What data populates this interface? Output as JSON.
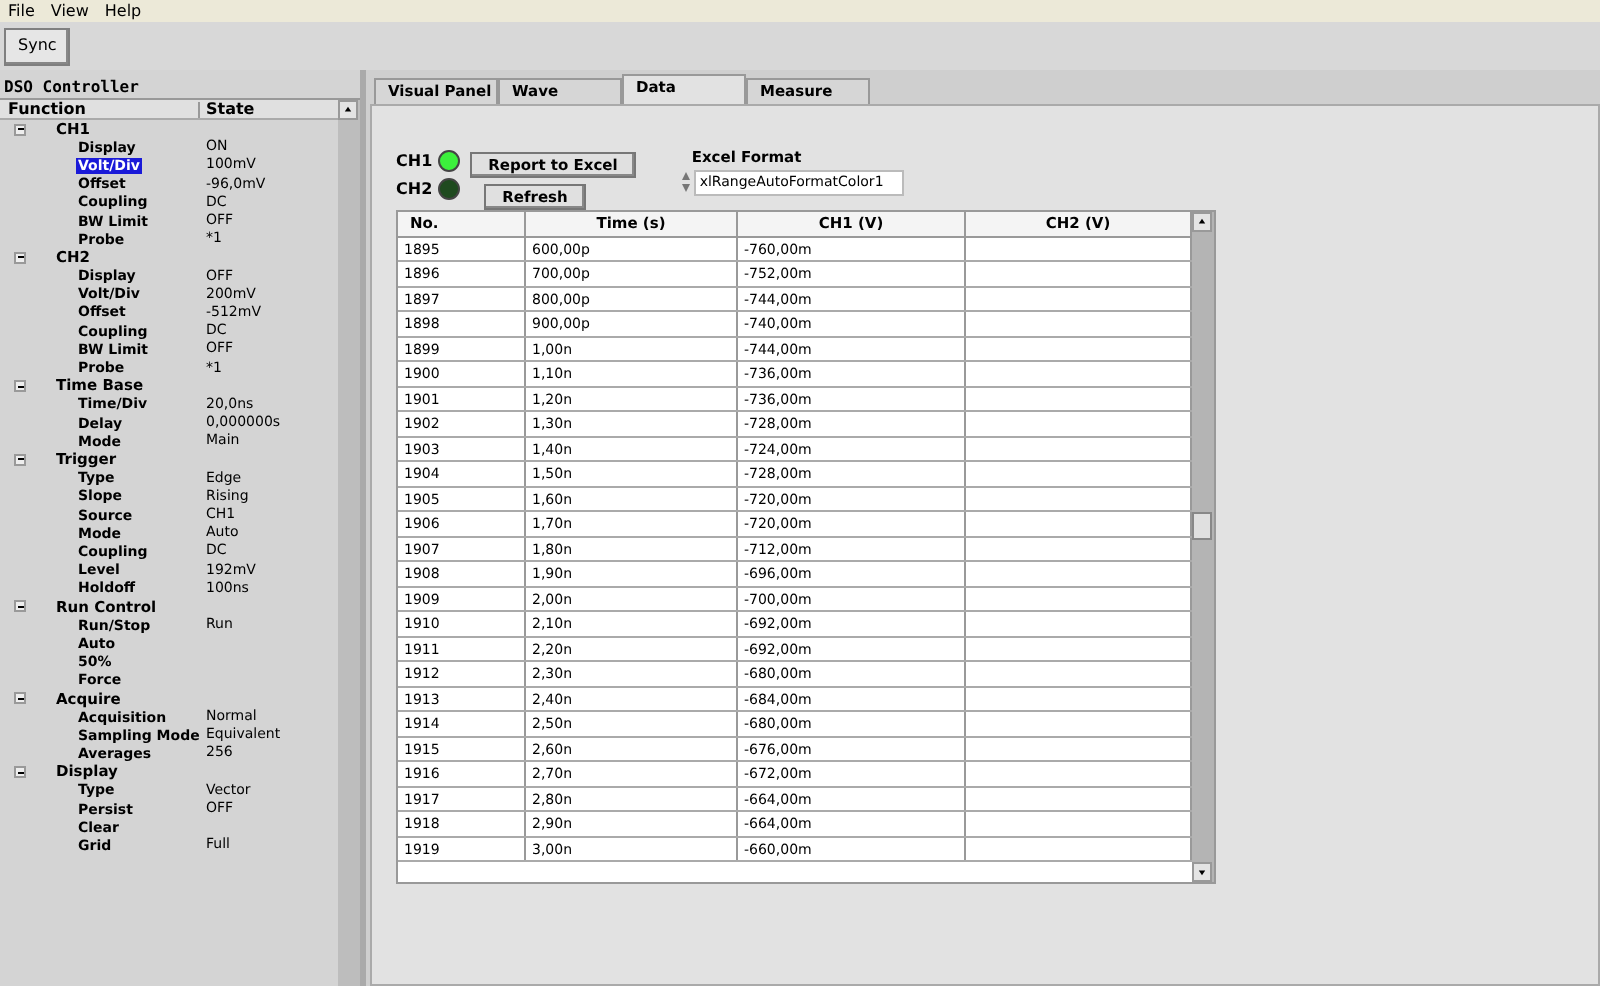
{
  "menu": [
    "File",
    "View",
    "Help"
  ],
  "toolbar": {
    "sync_button": "Sync"
  },
  "controller": {
    "title": "DSO Controller",
    "columns": [
      "Function",
      "State"
    ],
    "tree": [
      {
        "label": "CH1",
        "expanded": true,
        "children": [
          {
            "label": "Display",
            "state": "ON",
            "selected": false
          },
          {
            "label": "Volt/Div",
            "state": "100mV",
            "selected": true
          },
          {
            "label": "Offset",
            "state": "-96,0mV",
            "selected": false
          },
          {
            "label": "Coupling",
            "state": "DC",
            "selected": false
          },
          {
            "label": "BW Limit",
            "state": "OFF",
            "selected": false
          },
          {
            "label": "Probe",
            "state": "*1",
            "selected": false
          }
        ]
      },
      {
        "label": "CH2",
        "expanded": true,
        "children": [
          {
            "label": "Display",
            "state": "OFF",
            "selected": false
          },
          {
            "label": "Volt/Div",
            "state": "200mV",
            "selected": false
          },
          {
            "label": "Offset",
            "state": "-512mV",
            "selected": false
          },
          {
            "label": "Coupling",
            "state": "DC",
            "selected": false
          },
          {
            "label": "BW Limit",
            "state": "OFF",
            "selected": false
          },
          {
            "label": "Probe",
            "state": "*1",
            "selected": false
          }
        ]
      },
      {
        "label": "Time Base",
        "expanded": true,
        "children": [
          {
            "label": "Time/Div",
            "state": "20,0ns",
            "selected": false
          },
          {
            "label": "Delay",
            "state": "0,000000s",
            "selected": false
          },
          {
            "label": "Mode",
            "state": "Main",
            "selected": false
          }
        ]
      },
      {
        "label": "Trigger",
        "expanded": true,
        "children": [
          {
            "label": "Type",
            "state": "Edge",
            "selected": false
          },
          {
            "label": "Slope",
            "state": "Rising",
            "selected": false
          },
          {
            "label": "Source",
            "state": "CH1",
            "selected": false
          },
          {
            "label": "Mode",
            "state": "Auto",
            "selected": false
          },
          {
            "label": "Coupling",
            "state": "DC",
            "selected": false
          },
          {
            "label": "Level",
            "state": "192mV",
            "selected": false
          },
          {
            "label": "Holdoff",
            "state": "100ns",
            "selected": false
          }
        ]
      },
      {
        "label": "Run Control",
        "expanded": true,
        "children": [
          {
            "label": "Run/Stop",
            "state": "Run",
            "selected": false
          },
          {
            "label": "Auto",
            "selected": false
          },
          {
            "label": "50%",
            "selected": false
          },
          {
            "label": "Force",
            "selected": false
          }
        ]
      },
      {
        "label": "Acquire",
        "expanded": true,
        "children": [
          {
            "label": "Acquisition",
            "state": "Normal",
            "selected": false
          },
          {
            "label": "Sampling Mode",
            "state": "Equivalent",
            "selected": false
          },
          {
            "label": "Averages",
            "state": "256",
            "selected": false
          }
        ]
      },
      {
        "label": "Display",
        "expanded": true,
        "children": [
          {
            "label": "Type",
            "state": "Vector",
            "selected": false
          },
          {
            "label": "Persist",
            "state": "OFF",
            "selected": false
          },
          {
            "label": "Clear",
            "selected": false
          },
          {
            "label": "Grid",
            "state": "Full",
            "selected": false
          }
        ]
      }
    ]
  },
  "tabs": [
    {
      "label": "Visual Panel",
      "selected": false
    },
    {
      "label": "Wave",
      "selected": false
    },
    {
      "label": "Data",
      "selected": true
    },
    {
      "label": "Measure",
      "selected": false
    }
  ],
  "data_tab": {
    "leds": [
      {
        "label": "CH1",
        "on": true
      },
      {
        "label": "CH2",
        "on": false
      }
    ],
    "report_button": "Report to Excel",
    "refresh_button": "Refresh",
    "excel_format": {
      "label": "Excel Format",
      "value": "xlRangeAutoFormatColor1"
    },
    "table": {
      "columns": [
        "No.",
        "Time (s)",
        "CH1 (V)",
        "CH2 (V)"
      ],
      "rows": [
        [
          "1895",
          "600,00p",
          "-760,00m"
        ],
        [
          "1896",
          "700,00p",
          "-752,00m"
        ],
        [
          "1897",
          "800,00p",
          "-744,00m"
        ],
        [
          "1898",
          "900,00p",
          "-740,00m"
        ],
        [
          "1899",
          "1,00n",
          "-744,00m"
        ],
        [
          "1900",
          "1,10n",
          "-736,00m"
        ],
        [
          "1901",
          "1,20n",
          "-736,00m"
        ],
        [
          "1902",
          "1,30n",
          "-728,00m"
        ],
        [
          "1903",
          "1,40n",
          "-724,00m"
        ],
        [
          "1904",
          "1,50n",
          "-728,00m"
        ],
        [
          "1905",
          "1,60n",
          "-720,00m"
        ],
        [
          "1906",
          "1,70n",
          "-720,00m"
        ],
        [
          "1907",
          "1,80n",
          "-712,00m"
        ],
        [
          "1908",
          "1,90n",
          "-696,00m"
        ],
        [
          "1909",
          "2,00n",
          "-700,00m"
        ],
        [
          "1910",
          "2,10n",
          "-692,00m"
        ],
        [
          "1911",
          "2,20n",
          "-692,00m"
        ],
        [
          "1912",
          "2,30n",
          "-680,00m"
        ],
        [
          "1913",
          "2,40n",
          "-684,00m"
        ],
        [
          "1914",
          "2,50n",
          "-680,00m"
        ],
        [
          "1915",
          "2,60n",
          "-676,00m"
        ],
        [
          "1916",
          "2,70n",
          "-672,00m"
        ],
        [
          "1917",
          "2,80n",
          "-664,00m"
        ],
        [
          "1918",
          "2,90n",
          "-664,00m"
        ],
        [
          "1919",
          "3,00n",
          "-660,00m"
        ]
      ]
    }
  }
}
